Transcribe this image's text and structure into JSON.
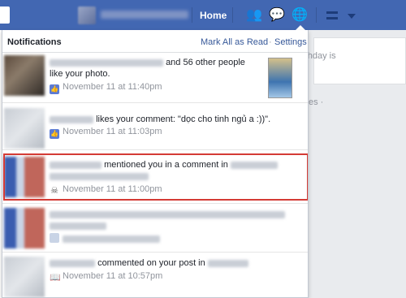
{
  "topbar": {
    "home_label": "Home"
  },
  "background": {
    "right_text_line1": "rthday is",
    "right_text_line2": "",
    "right_dot": "es ·"
  },
  "notifications": {
    "title": "Notifications",
    "mark_all": "Mark All as Read",
    "separator": "·",
    "settings": "Settings",
    "items": [
      {
        "line1": "and 56 other people",
        "line2": "like your photo.",
        "time": "November 11 at 11:40pm",
        "icon": "like-icon"
      },
      {
        "line1": "likes your comment: \"dọc cho tinh ngủ a :))\".",
        "time": "November 11 at 11:03pm",
        "icon": "like-icon"
      },
      {
        "line1": "mentioned you in a comment in",
        "time": "November 11 at 11:00pm",
        "icon": "skull-icon"
      },
      {
        "line1": "",
        "time": "",
        "icon": "group-icon"
      },
      {
        "line1": "commented on your post in",
        "time": "November 11 at 10:57pm",
        "icon": "book-icon"
      }
    ]
  },
  "colors": {
    "topbar": "#4267b2",
    "link": "#365899",
    "highlight": "#d43b35"
  }
}
